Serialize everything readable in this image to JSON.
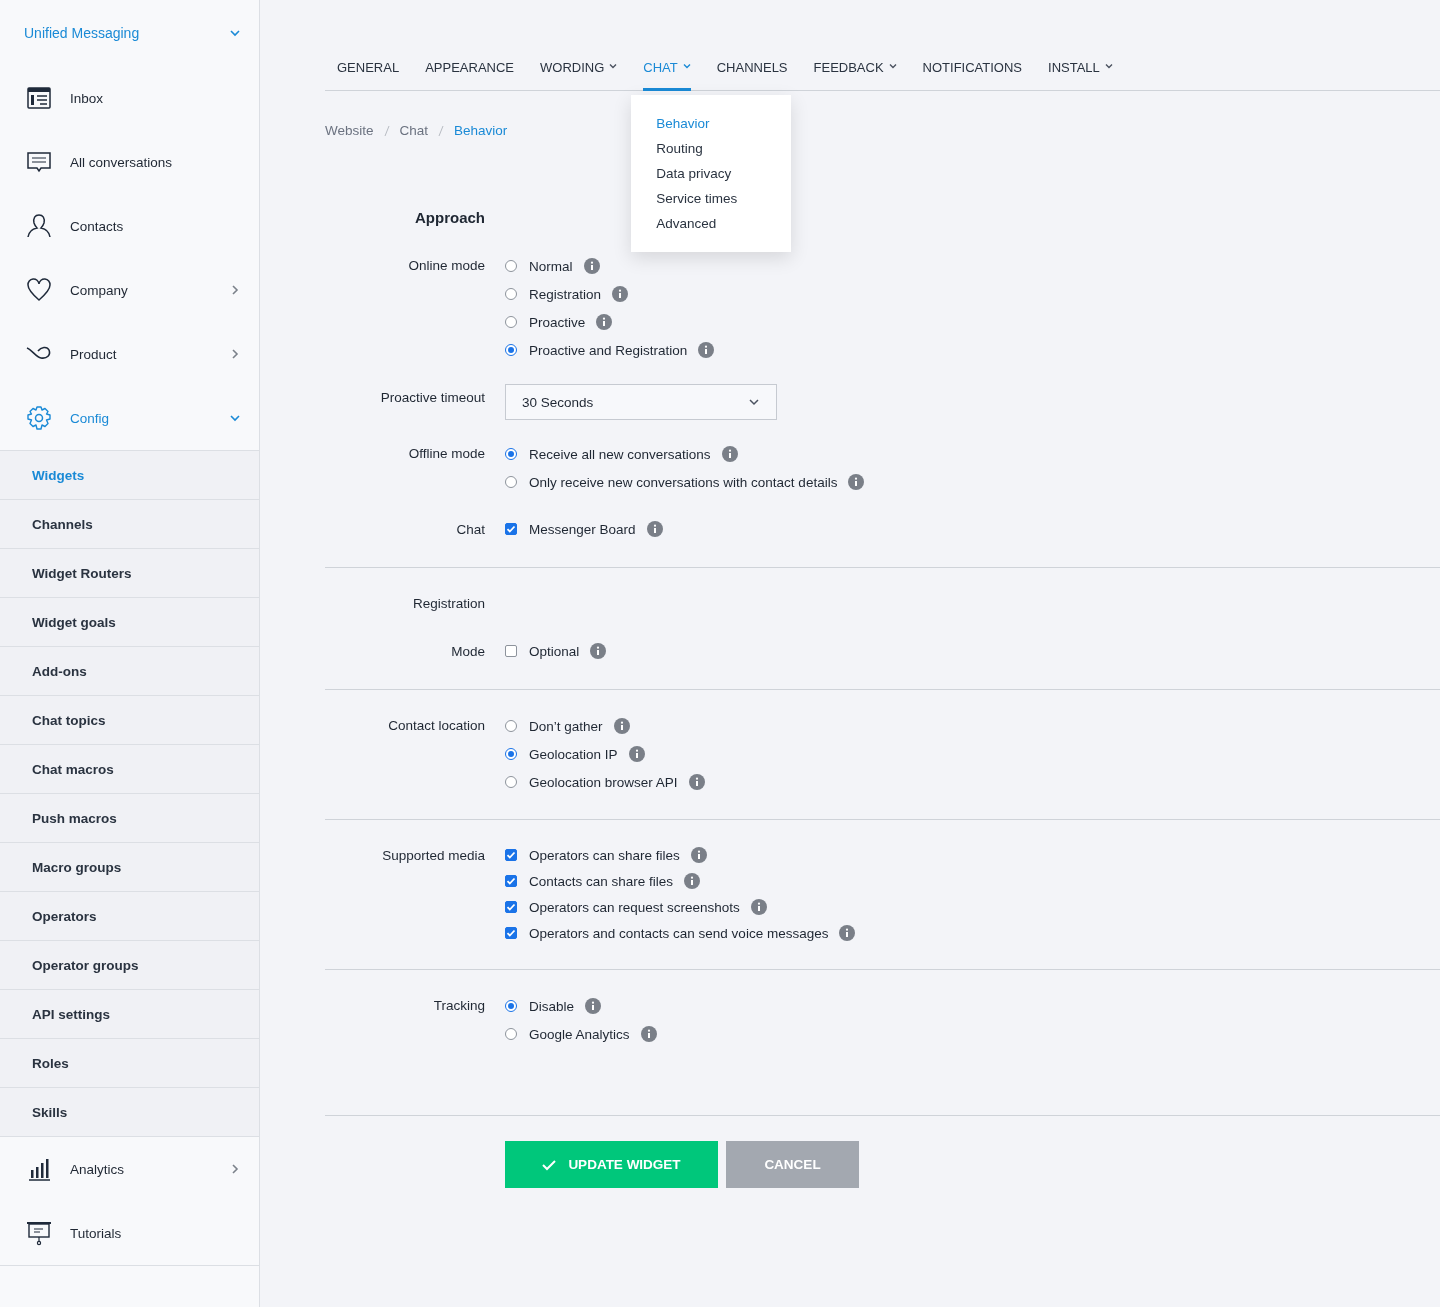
{
  "sidebar": {
    "header": {
      "label": "Unified Messaging",
      "expanded": true
    },
    "items": [
      {
        "label": "Inbox",
        "selected": false
      },
      {
        "label": "All conversations",
        "selected": false
      },
      {
        "label": "Contacts",
        "selected": false
      },
      {
        "label": "Company",
        "selected": false,
        "expanded": false
      },
      {
        "label": "Product",
        "selected": false,
        "expanded": false
      },
      {
        "label": "Config",
        "selected": true,
        "expanded": true,
        "children": [
          {
            "label": "Widgets",
            "selected": true
          },
          {
            "label": "Channels",
            "selected": false
          },
          {
            "label": "Widget Routers",
            "selected": false
          },
          {
            "label": "Widget goals",
            "selected": false
          },
          {
            "label": "Add-ons",
            "selected": false
          },
          {
            "label": "Chat topics",
            "selected": false
          },
          {
            "label": "Chat macros",
            "selected": false
          },
          {
            "label": "Push macros",
            "selected": false
          },
          {
            "label": "Macro groups",
            "selected": false
          },
          {
            "label": "Operators",
            "selected": false
          },
          {
            "label": "Operator groups",
            "selected": false
          },
          {
            "label": "API settings",
            "selected": false
          },
          {
            "label": "Roles",
            "selected": false
          },
          {
            "label": "Skills",
            "selected": false
          }
        ]
      },
      {
        "label": "Analytics",
        "selected": false,
        "expanded": false
      },
      {
        "label": "Tutorials",
        "selected": false
      }
    ]
  },
  "tabs": [
    {
      "label": "GENERAL",
      "selected": false,
      "dropdown": false
    },
    {
      "label": "APPEARANCE",
      "selected": false,
      "dropdown": false
    },
    {
      "label": "WORDING",
      "selected": false,
      "dropdown": true
    },
    {
      "label": "CHAT",
      "selected": true,
      "dropdown": true,
      "menu": [
        {
          "label": "Behavior",
          "selected": true
        },
        {
          "label": "Routing",
          "selected": false
        },
        {
          "label": "Data privacy",
          "selected": false
        },
        {
          "label": "Service times",
          "selected": false
        },
        {
          "label": "Advanced",
          "selected": false
        }
      ]
    },
    {
      "label": "CHANNELS",
      "selected": false,
      "dropdown": false
    },
    {
      "label": "FEEDBACK",
      "selected": false,
      "dropdown": true
    },
    {
      "label": "NOTIFICATIONS",
      "selected": false,
      "dropdown": false
    },
    {
      "label": "INSTALL",
      "selected": false,
      "dropdown": true
    }
  ],
  "breadcrumb": [
    "Website",
    "Chat",
    "Behavior"
  ],
  "sections": [
    {
      "rows": [
        {
          "kind": "heading",
          "label": "Approach"
        },
        {
          "kind": "radio",
          "label": "Online mode",
          "options": [
            {
              "label": "Normal",
              "selected": false
            },
            {
              "label": "Registration",
              "selected": false
            },
            {
              "label": "Proactive",
              "selected": false
            },
            {
              "label": "Proactive and Registration",
              "selected": true
            }
          ]
        },
        {
          "kind": "select",
          "label": "Proactive timeout",
          "value": "30 Seconds"
        },
        {
          "kind": "radio",
          "label": "Offline mode",
          "options": [
            {
              "label": "Receive all new conversations",
              "selected": true
            },
            {
              "label": "Only receive new conversations with contact details",
              "selected": false
            }
          ]
        },
        {
          "kind": "checkbox",
          "label": "Chat",
          "options": [
            {
              "label": "Messenger Board",
              "checked": true
            }
          ]
        }
      ]
    },
    {
      "rows": [
        {
          "kind": "label",
          "label": "Registration"
        },
        {
          "kind": "checkbox",
          "label": "Mode",
          "options": [
            {
              "label": "Optional",
              "checked": false
            }
          ]
        }
      ]
    },
    {
      "rows": [
        {
          "kind": "radio",
          "label": "Contact location",
          "options": [
            {
              "label": "Don’t gather",
              "selected": false
            },
            {
              "label": "Geolocation IP",
              "selected": true
            },
            {
              "label": "Geolocation browser API",
              "selected": false
            }
          ]
        }
      ]
    },
    {
      "rows": [
        {
          "kind": "checkbox",
          "label": "Supported media",
          "options": [
            {
              "label": "Operators can share files",
              "checked": true
            },
            {
              "label": "Contacts can share files",
              "checked": true
            },
            {
              "label": "Operators can request screenshots",
              "checked": true
            },
            {
              "label": "Operators and contacts can send voice messages",
              "checked": true
            }
          ]
        }
      ]
    },
    {
      "rows": [
        {
          "kind": "radio",
          "label": "Tracking",
          "options": [
            {
              "label": "Disable",
              "selected": true
            },
            {
              "label": "Google Analytics",
              "selected": false
            }
          ]
        }
      ]
    }
  ],
  "buttons": [
    {
      "label": "UPDATE WIDGET",
      "kind": "primary",
      "disabled": false
    },
    {
      "label": "CANCEL",
      "kind": "secondary",
      "disabled": true
    }
  ]
}
